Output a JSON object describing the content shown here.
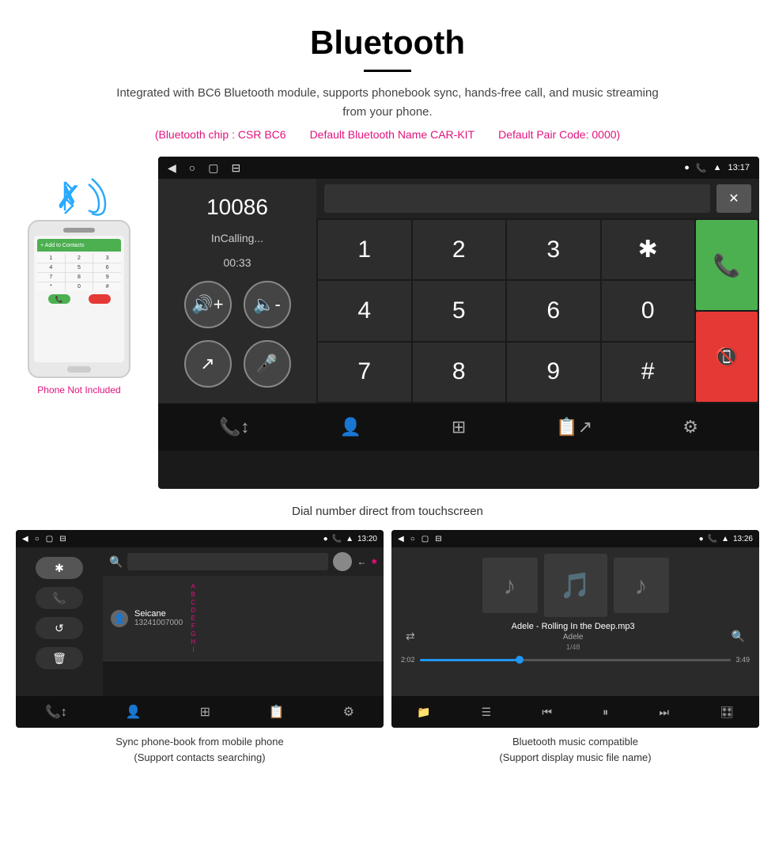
{
  "header": {
    "title": "Bluetooth",
    "description": "Integrated with BC6 Bluetooth module, supports phonebook sync, hands-free call, and music streaming from your phone.",
    "spec1": "(Bluetooth chip : CSR BC6",
    "spec2": "Default Bluetooth Name CAR-KIT",
    "spec3": "Default Pair Code: 0000)"
  },
  "phone_label": "Phone Not Included",
  "main_caption": "Dial number direct from touchscreen",
  "dial_screen": {
    "number": "10086",
    "status": "InCalling...",
    "timer": "00:33",
    "time": "13:17",
    "keys": [
      "1",
      "2",
      "3",
      "*",
      "4",
      "5",
      "6",
      "0",
      "7",
      "8",
      "9",
      "#"
    ]
  },
  "bottom_left": {
    "time": "13:20",
    "contact_name": "Seicane",
    "contact_number": "13241007000",
    "alpha_letters": [
      "A",
      "B",
      "C",
      "D",
      "E",
      "F",
      "G",
      "H",
      "I"
    ],
    "caption_line1": "Sync phone-book from mobile phone",
    "caption_line2": "(Support contacts searching)"
  },
  "bottom_right": {
    "time": "13:26",
    "track_title": "Adele - Rolling In the Deep.mp3",
    "track_artist": "Adele",
    "track_info": "1/48",
    "time_current": "2:02",
    "time_total": "3:49",
    "caption_line1": "Bluetooth music compatible",
    "caption_line2": "(Support display music file name)"
  }
}
